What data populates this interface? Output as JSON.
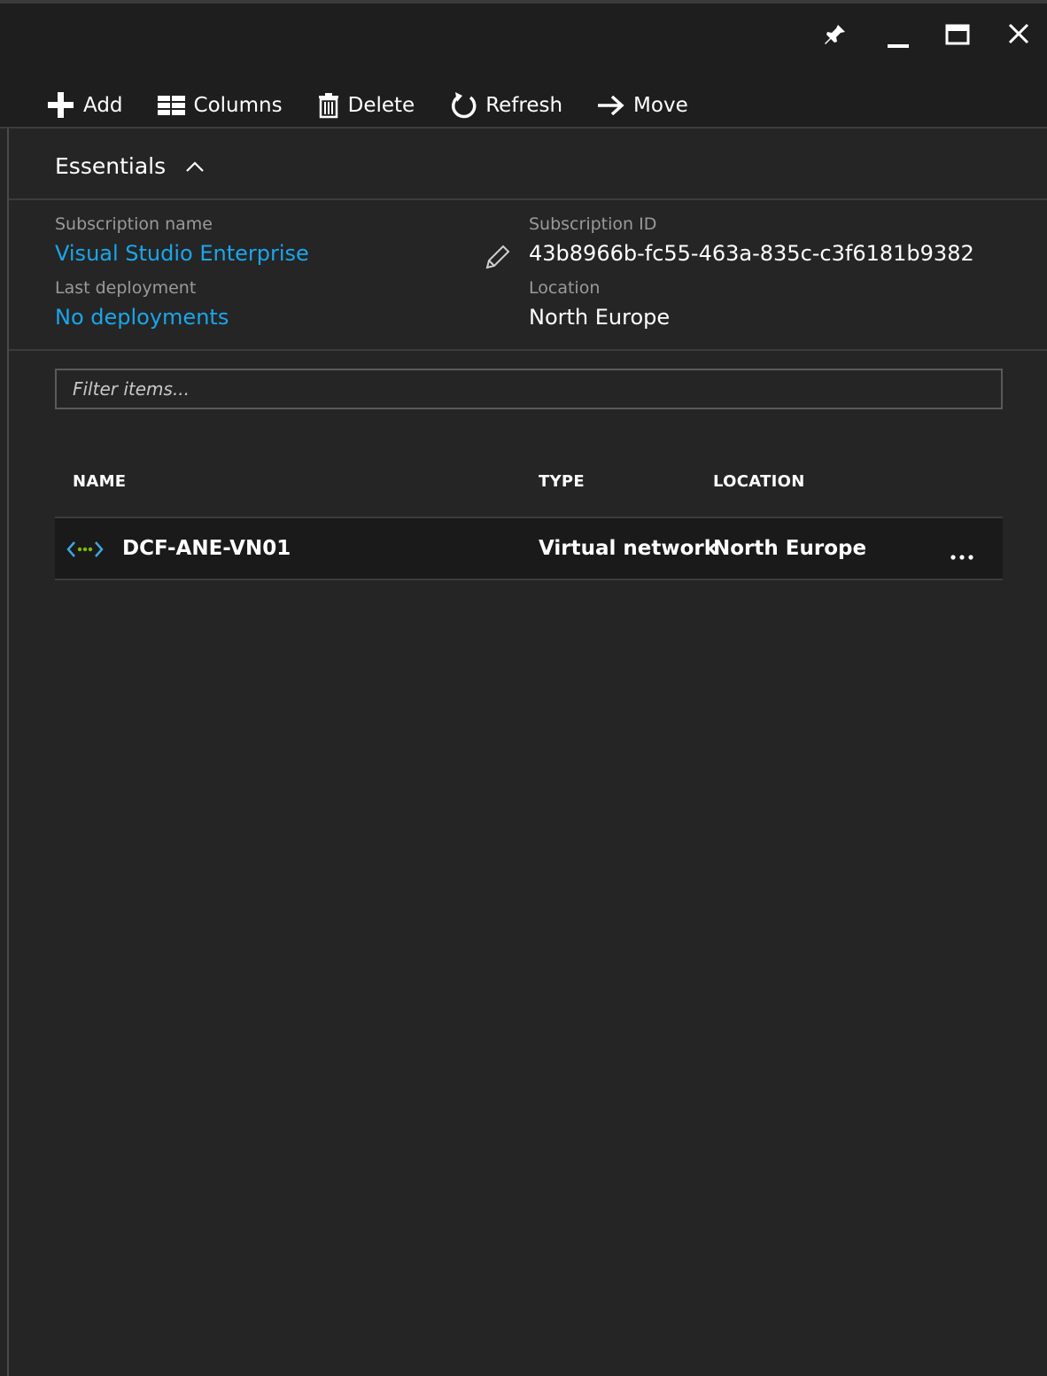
{
  "window": {
    "controls": {
      "pin_icon": "pin-icon",
      "minimize_icon": "minimize-icon",
      "maximize_icon": "maximize-icon",
      "close_icon": "close-icon"
    }
  },
  "toolbar": {
    "add_label": "Add",
    "columns_label": "Columns",
    "delete_label": "Delete",
    "refresh_label": "Refresh",
    "move_label": "Move"
  },
  "essentials": {
    "title": "Essentials",
    "subscription_name_label": "Subscription name",
    "subscription_name_value": "Visual Studio Enterprise",
    "last_deployment_label": "Last deployment",
    "last_deployment_value": "No deployments",
    "subscription_id_label": "Subscription ID",
    "subscription_id_value": "43b8966b-fc55-463a-835c-c3f6181b9382",
    "location_label": "Location",
    "location_value": "North Europe"
  },
  "filter": {
    "placeholder": "Filter items..."
  },
  "table": {
    "columns": [
      "NAME",
      "TYPE",
      "LOCATION"
    ],
    "rows": [
      {
        "name": "DCF-ANE-VN01",
        "type": "Virtual network",
        "location": "North Europe",
        "icon": "virtual-network-icon",
        "more": "..."
      }
    ]
  },
  "colors": {
    "background": "#252525",
    "header": "#1e1e1e",
    "link": "#19a6ec",
    "row": "#1a1a1a"
  }
}
